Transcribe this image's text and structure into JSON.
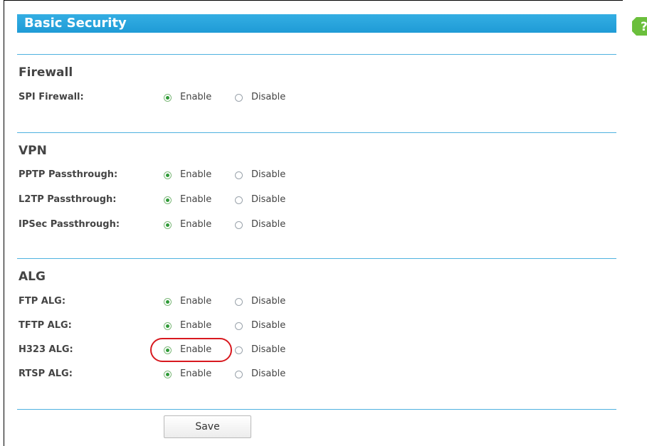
{
  "page": {
    "title": "Basic Security",
    "help_icon": "help-question-icon",
    "accent_color": "#1f9bd6"
  },
  "sections": {
    "firewall": {
      "title": "Firewall",
      "rows": [
        {
          "label": "SPI Firewall:",
          "enable": "Enable",
          "disable": "Disable",
          "selected": "enable"
        }
      ]
    },
    "vpn": {
      "title": "VPN",
      "rows": [
        {
          "label": "PPTP Passthrough:",
          "enable": "Enable",
          "disable": "Disable",
          "selected": "enable"
        },
        {
          "label": "L2TP Passthrough:",
          "enable": "Enable",
          "disable": "Disable",
          "selected": "enable"
        },
        {
          "label": "IPSec Passthrough:",
          "enable": "Enable",
          "disable": "Disable",
          "selected": "enable"
        }
      ]
    },
    "alg": {
      "title": "ALG",
      "rows": [
        {
          "label": "FTP ALG:",
          "enable": "Enable",
          "disable": "Disable",
          "selected": "enable"
        },
        {
          "label": "TFTP ALG:",
          "enable": "Enable",
          "disable": "Disable",
          "selected": "enable"
        },
        {
          "label": "H323 ALG:",
          "enable": "Enable",
          "disable": "Disable",
          "selected": "enable"
        },
        {
          "label": "RTSP ALG:",
          "enable": "Enable",
          "disable": "Disable",
          "selected": "enable"
        }
      ]
    }
  },
  "actions": {
    "save_label": "Save"
  }
}
